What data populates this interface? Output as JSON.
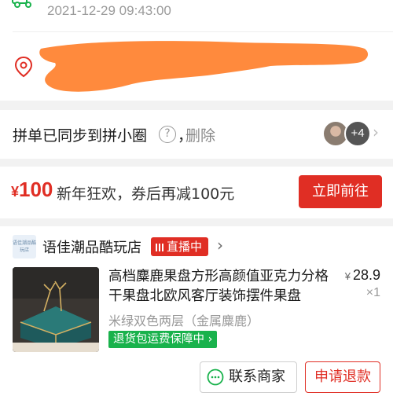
{
  "delivery": {
    "time": "2021-12-29 09:43:00",
    "address_redacted": true,
    "icons": [
      "truck-icon",
      "location-pin-icon"
    ]
  },
  "sync": {
    "text": "拼单已同步到拼小圈",
    "help": "?",
    "comma": "，",
    "delete_label": "删除",
    "avatar_more": "+4"
  },
  "promo": {
    "price_symbol": "¥",
    "price_value": "100",
    "text": "新年狂欢，券后再减100元",
    "button_label": "立即前往"
  },
  "order": {
    "shop_logo_text": "语佳潮品酷玩店",
    "shop_name": "语佳潮品酷玩店",
    "live_label": "直播中",
    "product_title": "高档麋鹿果盘方形高颜值亚克力分格干果盘北欧风客厅装饰摆件果盘",
    "price_symbol": "¥",
    "price": "28.9",
    "qty": "×1",
    "spec": "米绿双色两层（金属麋鹿）",
    "guarantee": "退货包运费保障中 ›",
    "contact_label": "联系商家",
    "refund_label": "申请退款"
  },
  "colors": {
    "accent_red": "#e02e24",
    "guarantee_green": "#19b24c",
    "redaction_orange": "#ff8a3d"
  }
}
